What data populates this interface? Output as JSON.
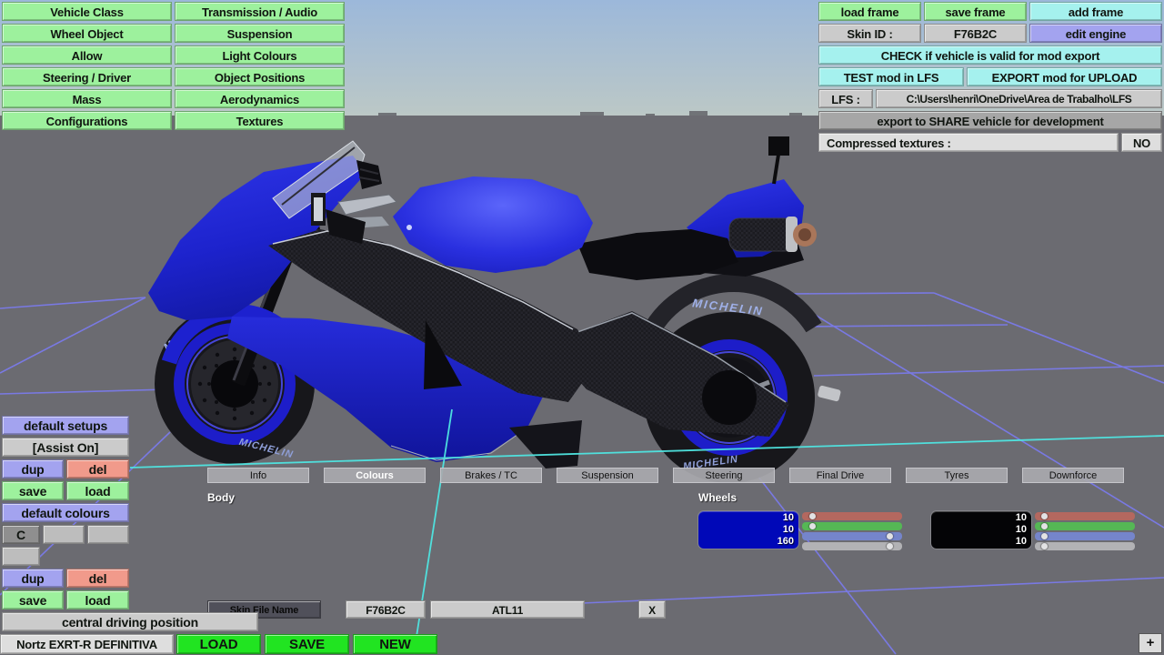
{
  "viewport": {
    "sky_top": "#9cb8da",
    "sky_bottom": "#bcc8c6",
    "ground": "#6b6b71",
    "grid_purple": "#7b7bf0",
    "grid_cyan": "#4fe6e2",
    "bike": {
      "body_blue": "#2026d6",
      "tire_black": "#17171b",
      "rim_blue": "#1e1ec8",
      "tire_brand": "MICHELIN"
    }
  },
  "top_left_menu": {
    "items": [
      "Vehicle Class",
      "Transmission / Audio",
      "Wheel Object",
      "Suspension",
      "Allow",
      "Light Colours",
      "Steering / Driver",
      "Object Positions",
      "Mass",
      "Aerodynamics",
      "Configurations",
      "Textures"
    ]
  },
  "top_right": {
    "load_frame": "load frame",
    "save_frame": "save frame",
    "add_frame": "add frame",
    "skin_id_label": "Skin ID :",
    "skin_id_value": "F76B2C",
    "edit_engine": "edit engine",
    "check_export": "CHECK if vehicle is valid for mod export",
    "test_mod": "TEST mod in LFS",
    "export_mod": "EXPORT mod for UPLOAD",
    "lfs_label": "LFS :",
    "lfs_path": "C:\\Users\\henri\\OneDrive\\Area de Trabalho\\LFS",
    "share_export": "export to SHARE vehicle for development",
    "compressed_label": "Compressed textures :",
    "compressed_value": "NO"
  },
  "setups_panel": {
    "default_setups": "default setups",
    "assist": "[Assist On]",
    "dup": "dup",
    "del": "del",
    "save": "save",
    "load": "load",
    "default_colours": "default colours",
    "c_button": "C"
  },
  "bottom_bar": {
    "central_driving": "central driving position",
    "vehicle_name": "Nortz EXRT-R DEFINITIVA",
    "load": "LOAD",
    "save": "SAVE",
    "new": "NEW",
    "plus": "+"
  },
  "tabs": {
    "items": [
      "Info",
      "Colours",
      "Brakes / TC",
      "Suspension",
      "Steering",
      "Final Drive",
      "Tyres",
      "Downforce"
    ],
    "selected": "Colours"
  },
  "colours_panel": {
    "body_label": "Body",
    "wheels_label": "Wheels",
    "body": {
      "swatch_color": "#0008b8",
      "values": [
        "10",
        "10",
        "160"
      ],
      "slider_pos": [
        0.06,
        0.06,
        0.93,
        0.93
      ]
    },
    "wheels": {
      "swatch_color": "#040406",
      "values": [
        "10",
        "10",
        "10"
      ],
      "slider_pos": [
        0.05,
        0.05,
        0.05,
        0.05
      ]
    },
    "slider_colors": [
      "#b4685f",
      "#55b755",
      "#7585cb",
      "#b2b2b5"
    ]
  },
  "skin_row": {
    "label": "Skin File Name",
    "skin_value": "F76B2C",
    "name_value": "ATL11",
    "close": "X"
  }
}
